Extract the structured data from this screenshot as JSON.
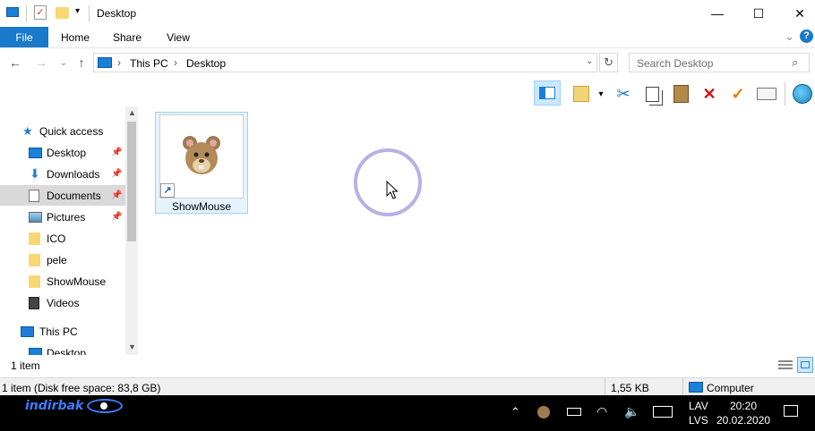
{
  "window": {
    "title": "Desktop",
    "minimize_glyph": "—",
    "maximize_glyph": "☐",
    "close_glyph": "✕"
  },
  "ribbon": {
    "tabs": [
      "File",
      "Home",
      "Share",
      "View"
    ],
    "expand_glyph": "⌄",
    "help_glyph": "?"
  },
  "address": {
    "segments": [
      "This PC",
      "Desktop"
    ],
    "separator": "›",
    "search_placeholder": "Search Desktop"
  },
  "navpane": {
    "items": [
      {
        "label": "Quick access",
        "icon": "star-icon",
        "pinned": false
      },
      {
        "label": "Desktop",
        "icon": "desktop-icon",
        "pinned": true
      },
      {
        "label": "Downloads",
        "icon": "download-icon",
        "pinned": true
      },
      {
        "label": "Documents",
        "icon": "documents-icon",
        "pinned": true
      },
      {
        "label": "Pictures",
        "icon": "pictures-icon",
        "pinned": true
      },
      {
        "label": "ICO",
        "icon": "folder-icon",
        "pinned": false
      },
      {
        "label": "pele",
        "icon": "folder-icon",
        "pinned": false
      },
      {
        "label": "ShowMouse",
        "icon": "folder-icon",
        "pinned": false
      },
      {
        "label": "Videos",
        "icon": "videos-icon",
        "pinned": false
      },
      {
        "label": "This PC",
        "icon": "computer-icon",
        "pinned": false
      },
      {
        "label": "Desktop",
        "icon": "desktop-icon",
        "pinned": false
      }
    ],
    "selected": "Documents"
  },
  "content": {
    "items": [
      {
        "name": "ShowMouse",
        "icon": "mouse-icon",
        "shortcut": true
      }
    ]
  },
  "statusbar": {
    "item_count": "1 item",
    "details_left": "1 item (Disk free space: 83,8 GB)",
    "details_size": "1,55 KB",
    "details_location": "Computer"
  },
  "taskbar": {
    "brand": "indirbak",
    "lang_line1": "LAV",
    "lang_line2": "LVS",
    "time": "20:20",
    "date": "20.02.2020"
  },
  "colors": {
    "accent": "#1979ca",
    "selection": "#e5f3ff",
    "click_ring": "#b6b2e6"
  }
}
